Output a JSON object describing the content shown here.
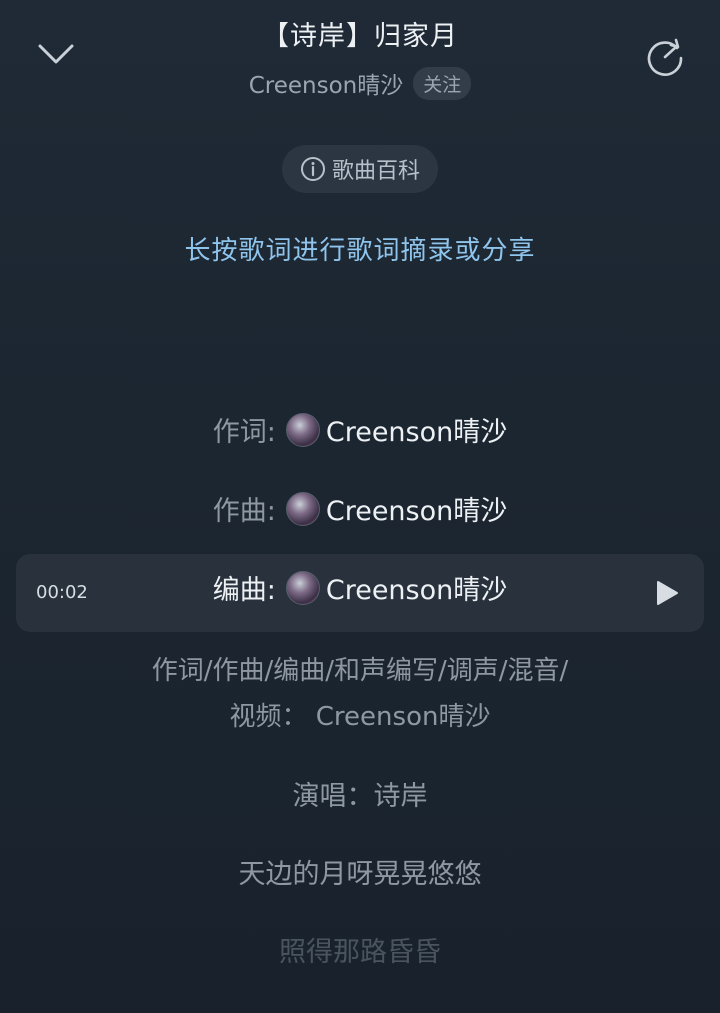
{
  "header": {
    "title": "【诗岸】归家月",
    "artist": "Creenson晴沙",
    "follow_label": "关注"
  },
  "wiki": {
    "label": "歌曲百科"
  },
  "hint": "长按歌词进行歌词摘录或分享",
  "credits_rows": [
    {
      "key": "作词:",
      "name": "Creenson晴沙"
    },
    {
      "key": "作曲:",
      "name": "Creenson晴沙"
    },
    {
      "key": "编曲:",
      "name": "Creenson晴沙"
    }
  ],
  "active_time": "00:02",
  "credits_full": {
    "line1": "作词/作曲/编曲/和声编写/调声/混音/",
    "line2": "视频： Creenson晴沙"
  },
  "lyrics": {
    "vocal": "演唱：诗岸",
    "line1": "天边的月呀晃晃悠悠",
    "line2": "照得那路昏昏"
  },
  "icons": {
    "collapse": "chevron-down-icon",
    "share": "share-rotate-icon",
    "info": "info-icon",
    "play": "play-icon",
    "avatar": "avatar"
  },
  "colors": {
    "background": "#1f2a36",
    "hint": "#8fc4ec",
    "highlight_row": "#28313c"
  }
}
